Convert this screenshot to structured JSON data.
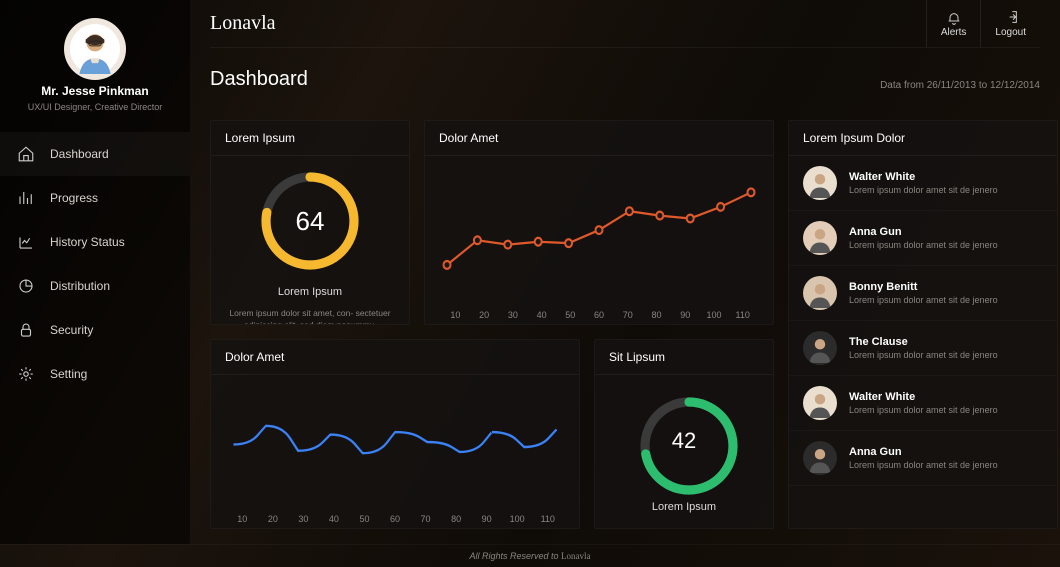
{
  "brand": "Lonavla",
  "profile": {
    "name": "Mr. Jesse Pinkman",
    "role": "UX/UI Designer, Creative Director"
  },
  "nav": [
    {
      "icon": "home",
      "label": "Dashboard",
      "active": true
    },
    {
      "icon": "bars",
      "label": "Progress"
    },
    {
      "icon": "history",
      "label": "History Status"
    },
    {
      "icon": "pie",
      "label": "Distribution"
    },
    {
      "icon": "lock",
      "label": "Security"
    },
    {
      "icon": "gear",
      "label": "Setting"
    }
  ],
  "top_actions": {
    "alerts": "Alerts",
    "logout": "Logout"
  },
  "page": {
    "title": "Dashboard",
    "range": "Data from 26/11/2013 to 12/12/2014"
  },
  "cards": {
    "gauge1": {
      "title": "Lorem Ipsum",
      "value": 64,
      "percent": 0.78,
      "color": "#f5b82e",
      "label": "Lorem Ipsum",
      "desc": "Lorem ipsum dolor sit amet, con- sectetuer adipiscing elit, sed diam nonummy."
    },
    "line1": {
      "title": "Dolor Amet",
      "color": "#e0592a"
    },
    "people": {
      "title": "Lorem Ipsum Dolor",
      "items": [
        {
          "name": "Walter White",
          "sub": "Lorem ipsum dolor amet sit de jenero",
          "bg": "#eadfce"
        },
        {
          "name": "Anna Gun",
          "sub": "Lorem ipsum dolor amet sit de jenero",
          "bg": "#e3cdb8"
        },
        {
          "name": "Bonny Benitt",
          "sub": "Lorem ipsum dolor amet sit de jenero",
          "bg": "#d9c4ad"
        },
        {
          "name": "The Clause",
          "sub": "Lorem ipsum dolor amet sit de jenero",
          "bg": "#2b2b2b"
        },
        {
          "name": "Walter White",
          "sub": "Lorem ipsum dolor amet sit de jenero",
          "bg": "#eadfce"
        },
        {
          "name": "Anna Gun",
          "sub": "Lorem ipsum dolor amet sit de jenero",
          "bg": "#2b2b2b"
        }
      ]
    },
    "line2": {
      "title": "Dolor Amet",
      "color": "#3b82f6"
    },
    "gauge2": {
      "title": "Sit Lipsum",
      "value": 42,
      "percent": 0.72,
      "color": "#2dbd6e",
      "label": "Lorem Ipsum"
    }
  },
  "chart_data": [
    {
      "id": "line1",
      "type": "line",
      "title": "Dolor Amet",
      "x": [
        10,
        20,
        30,
        40,
        50,
        60,
        70,
        80,
        90,
        100,
        110
      ],
      "values": [
        18,
        35,
        32,
        34,
        33,
        42,
        55,
        52,
        50,
        58,
        68
      ],
      "ylim": [
        0,
        80
      ],
      "markers": true,
      "color": "#e0592a"
    },
    {
      "id": "line2",
      "type": "line",
      "title": "Dolor Amet",
      "x": [
        10,
        20,
        30,
        40,
        50,
        60,
        70,
        80,
        90,
        100,
        110
      ],
      "values": [
        40,
        55,
        35,
        48,
        33,
        50,
        42,
        34,
        50,
        38,
        52
      ],
      "ylim": [
        0,
        80
      ],
      "markers": false,
      "smooth": true,
      "color": "#3b82f6"
    },
    {
      "id": "gauge1",
      "type": "pie",
      "title": "Lorem Ipsum",
      "value": 64,
      "fill_fraction": 0.78,
      "color": "#f5b82e"
    },
    {
      "id": "gauge2",
      "type": "pie",
      "title": "Sit Lipsum",
      "value": 42,
      "fill_fraction": 0.72,
      "color": "#2dbd6e"
    }
  ],
  "footer": {
    "text": "All Rights Reserved to ",
    "brand": "Lonavla"
  }
}
